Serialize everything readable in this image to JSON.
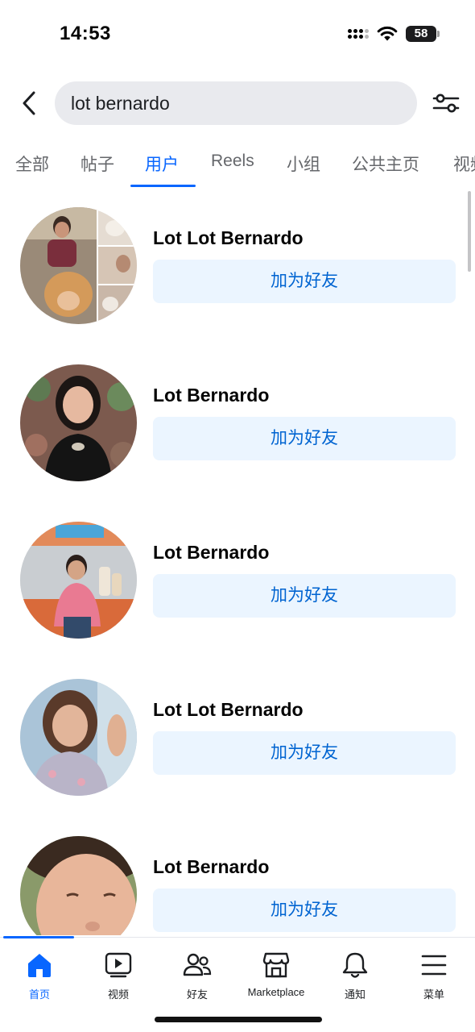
{
  "status_bar": {
    "time": "14:53",
    "battery": "58",
    "icons": [
      "cellular-signal-icon",
      "wifi-icon",
      "battery-icon"
    ]
  },
  "search": {
    "query": "lot bernardo",
    "icons": [
      "back-chevron-icon",
      "filter-sliders-icon"
    ]
  },
  "tabs": [
    {
      "label": "全部",
      "active": false
    },
    {
      "label": "帖子",
      "active": false
    },
    {
      "label": "用户",
      "active": true
    },
    {
      "label": "Reels",
      "active": false
    },
    {
      "label": "小组",
      "active": false
    },
    {
      "label": "公共主页",
      "active": false
    },
    {
      "label": "视频",
      "active": false
    }
  ],
  "results": [
    {
      "name": "Lot Lot Bernardo",
      "action": "加为好友"
    },
    {
      "name": "Lot Bernardo",
      "action": "加为好友"
    },
    {
      "name": "Lot Bernardo",
      "action": "加为好友"
    },
    {
      "name": "Lot Lot Bernardo",
      "action": "加为好友"
    },
    {
      "name": "Lot Bernardo",
      "action": "加为好友"
    }
  ],
  "bottom_nav": [
    {
      "label": "首页",
      "icon": "home-icon",
      "active": true
    },
    {
      "label": "视频",
      "icon": "video-icon",
      "active": false
    },
    {
      "label": "好友",
      "icon": "friends-icon",
      "active": false
    },
    {
      "label": "Marketplace",
      "icon": "marketplace-icon",
      "active": false
    },
    {
      "label": "通知",
      "icon": "bell-icon",
      "active": false
    },
    {
      "label": "菜单",
      "icon": "menu-icon",
      "active": false
    }
  ],
  "colors": {
    "accent": "#0866ff",
    "button_bg": "#ebf5ff",
    "button_text": "#0064d1",
    "search_bg": "#e9eaee",
    "secondary_text": "#65676b"
  }
}
